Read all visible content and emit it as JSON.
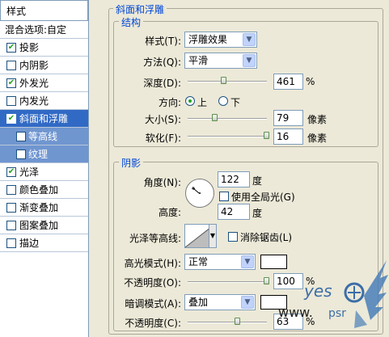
{
  "styles_panel": {
    "header": "样式",
    "blend_options": "混合选项:自定",
    "items": [
      {
        "label": "投影",
        "checked": true
      },
      {
        "label": "内阴影",
        "checked": false
      },
      {
        "label": "外发光",
        "checked": true
      },
      {
        "label": "内发光",
        "checked": false
      },
      {
        "label": "斜面和浮雕",
        "checked": true
      },
      {
        "label": "等高线",
        "checked": false
      },
      {
        "label": "纹理",
        "checked": false
      },
      {
        "label": "光泽",
        "checked": true
      },
      {
        "label": "颜色叠加",
        "checked": false
      },
      {
        "label": "渐变叠加",
        "checked": false
      },
      {
        "label": "图案叠加",
        "checked": false
      },
      {
        "label": "描边",
        "checked": false
      }
    ]
  },
  "bevel": {
    "title": "斜面和浮雕",
    "structure": {
      "title": "结构",
      "style_label": "样式(T):",
      "style_value": "浮雕效果",
      "technique_label": "方法(Q):",
      "technique_value": "平滑",
      "depth_label": "深度(D):",
      "depth_value": "461",
      "depth_unit": "%",
      "direction_label": "方向:",
      "direction_up": "上",
      "direction_down": "下",
      "size_label": "大小(S):",
      "size_value": "79",
      "size_unit": "像素",
      "soften_label": "软化(F):",
      "soften_value": "16",
      "soften_unit": "像素"
    },
    "shading": {
      "title": "阴影",
      "angle_label": "角度(N):",
      "angle_value": "122",
      "angle_unit": "度",
      "global_light_label": "使用全局光(G)",
      "altitude_label": "高度:",
      "altitude_value": "42",
      "altitude_unit": "度",
      "gloss_contour_label": "光泽等高线:",
      "anti_alias_label": "消除锯齿(L)",
      "highlight_mode_label": "高光模式(H):",
      "highlight_mode_value": "正常",
      "highlight_opacity_label": "不透明度(O):",
      "highlight_opacity_value": "100",
      "highlight_opacity_unit": "%",
      "shadow_mode_label": "暗调模式(A):",
      "shadow_mode_value": "叠加",
      "shadow_opacity_label": "不透明度(C):",
      "shadow_opacity_value": "63",
      "shadow_opacity_unit": "%"
    }
  },
  "watermark": {
    "text1": "yes",
    "text2": "www.",
    "text3": "psr"
  },
  "colors": {
    "selected": "#316ac5",
    "sub_selected": "#7096d0",
    "title_blue": "#0046d5",
    "highlight_color": "#ffffff",
    "shadow_color": "#ffffff"
  }
}
